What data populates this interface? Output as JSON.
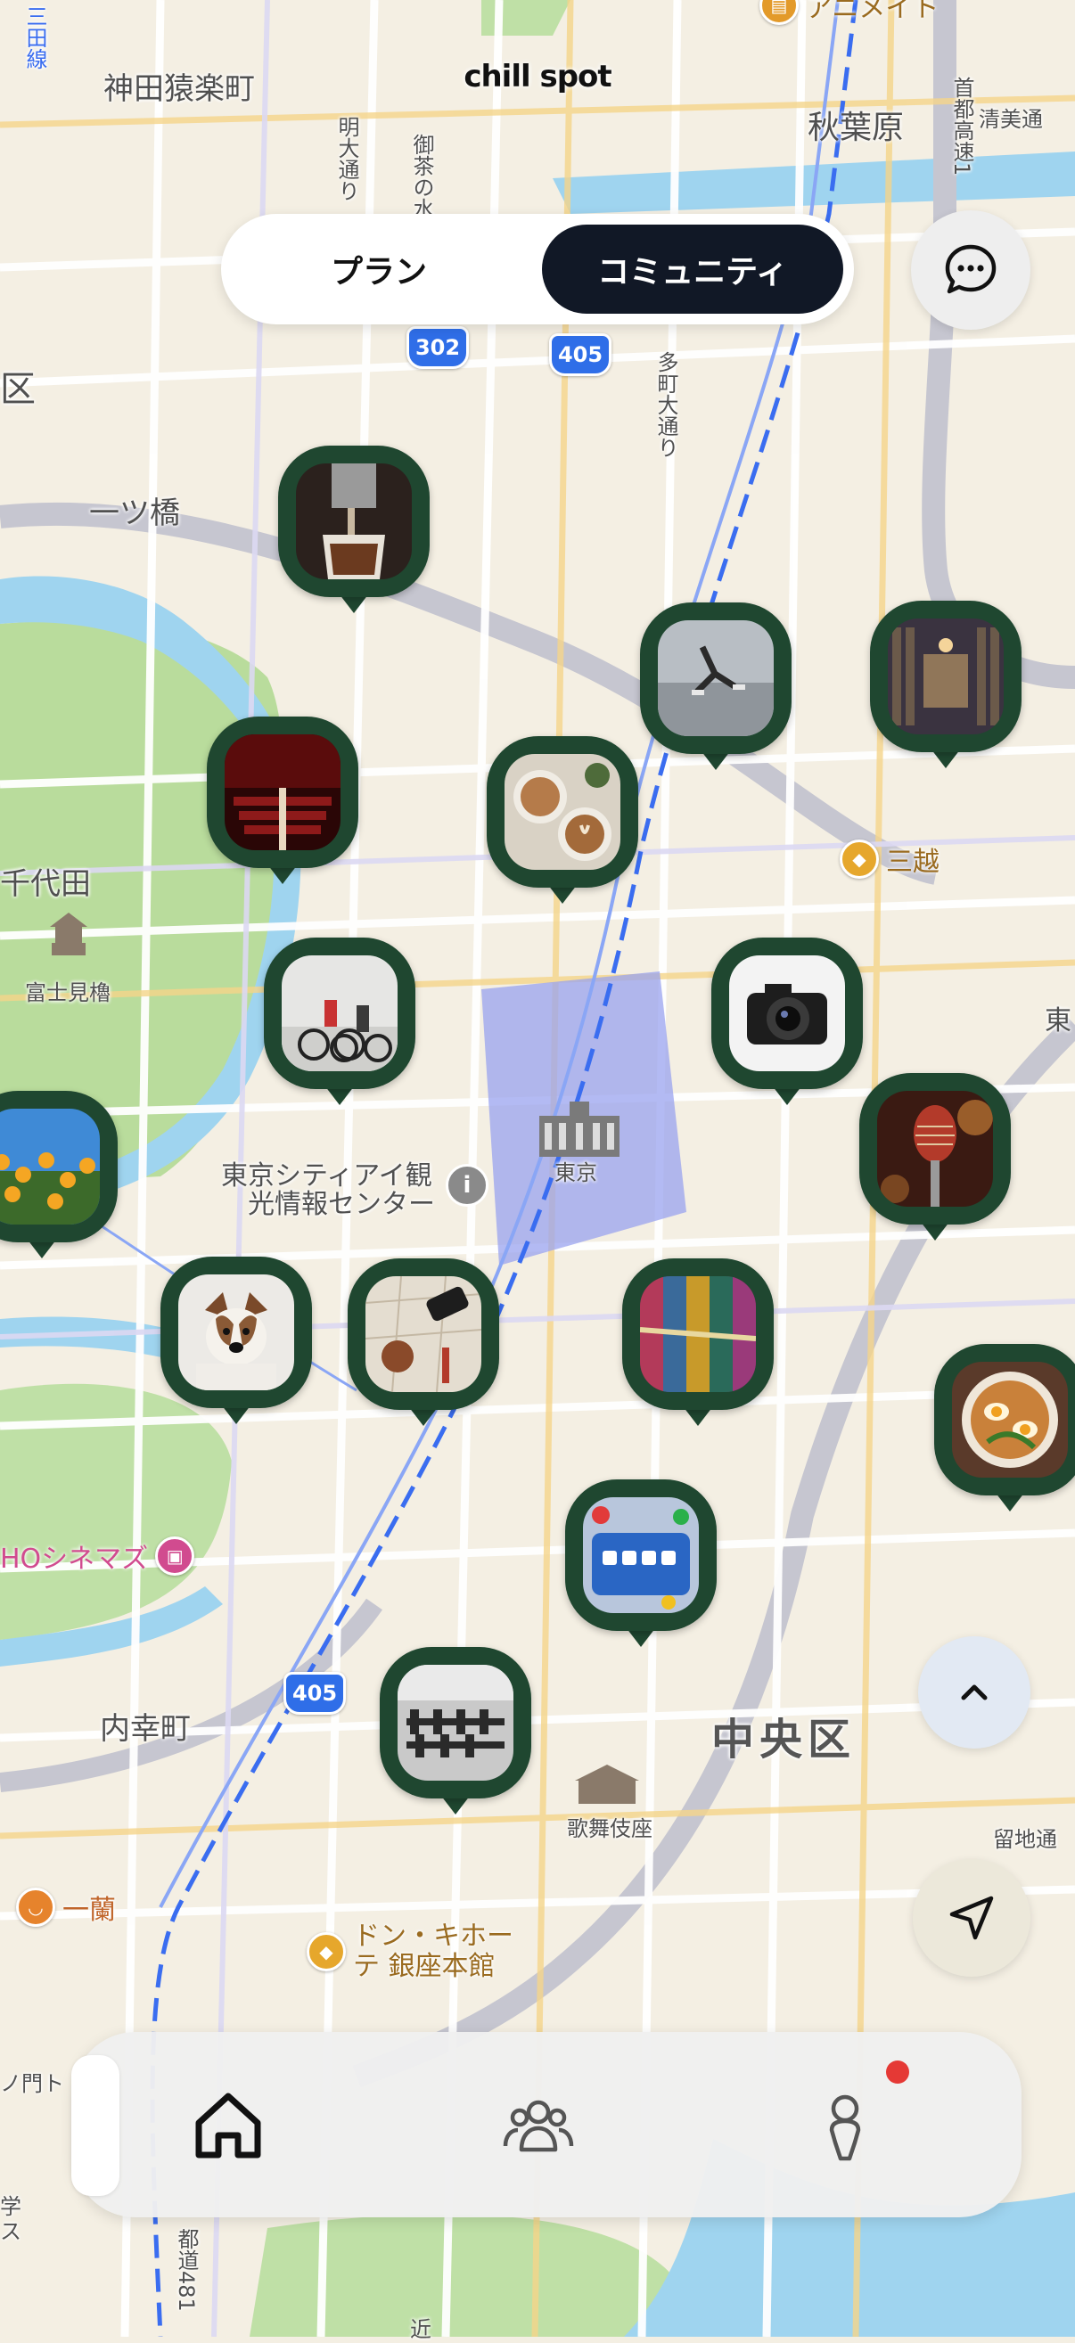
{
  "header": {
    "app_name": "chill spot"
  },
  "segmented": {
    "plan_label": "プラン",
    "community_label": "コミュニティ",
    "selected": "コミュニティ"
  },
  "map": {
    "labels": {
      "kanda": "神田猿楽町",
      "akihabara": "秋葉原",
      "hitotsubashi": "一ツ橋",
      "chiyoda": "千代田",
      "fujimi": "富士見櫓",
      "tic": "東京シティアイ観光情報センター",
      "tic1": "東京シティアイ観",
      "tic2": "光情報センター",
      "tokyo": "東京",
      "uchisaiwai": "内幸町",
      "chuo": "中央区",
      "kabukiza": "歌舞伎座",
      "taito": "清美通",
      "ku": "区",
      "higashi": "東",
      "mitoshi": "三田線",
      "meidai": "明大通り",
      "ochanomizu": "御茶の水",
      "tamachi": "多町大通り",
      "shuto": "首都高速1",
      "toei": "都道481",
      "ryuchi": "留地通",
      "kin": "近",
      "cinema": "HOシネマズ",
      "ichiran": "一蘭",
      "donki": "ドン・キホーテ 銀座本館",
      "mitsukoshi": "三越",
      "animate": "アニメイト",
      "gaku": "学",
      "nomon": "ノ門ト",
      "su": "ス"
    },
    "route_shields": [
      "302",
      "405",
      "405"
    ]
  },
  "pins": [
    {
      "subject": "coffee-pour"
    },
    {
      "subject": "runner"
    },
    {
      "subject": "library"
    },
    {
      "subject": "theater"
    },
    {
      "subject": "latte-art"
    },
    {
      "subject": "cyclists"
    },
    {
      "subject": "camera"
    },
    {
      "subject": "microphone"
    },
    {
      "subject": "flowers"
    },
    {
      "subject": "dog"
    },
    {
      "subject": "travel-items"
    },
    {
      "subject": "textiles"
    },
    {
      "subject": "ramen"
    },
    {
      "subject": "board-game"
    },
    {
      "subject": "gym"
    }
  ],
  "buttons": {
    "chat_icon": "chat-bubble-icon",
    "scroll_up_icon": "chevron-up-icon",
    "locate_icon": "navigation-arrow-icon"
  },
  "tabbar": {
    "tabs": [
      "home-icon",
      "community-icon",
      "profile-icon"
    ],
    "active": "home-icon",
    "profile_badge": true
  },
  "colors": {
    "pin": "#1f4730",
    "segment_active": "#111826",
    "badge": "#e53935",
    "rail": "#3a6df0"
  }
}
